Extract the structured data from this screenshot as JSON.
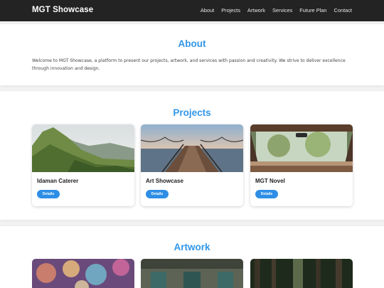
{
  "brand": "MGT Showcase",
  "nav": [
    "About",
    "Projects",
    "Artwork",
    "Services",
    "Future Plan",
    "Contact"
  ],
  "about": {
    "title": "About",
    "text": "Welcome to MGT Showcase, a platform to present our projects, artwork, and services with passion and creativity. We strive to deliver excellence through innovation and design."
  },
  "projects": {
    "title": "Projects",
    "items": [
      {
        "title": "Idaman Caterer",
        "button": "Details"
      },
      {
        "title": "Art Showcase",
        "button": "Details"
      },
      {
        "title": "MGT Novel",
        "button": "Details"
      }
    ]
  },
  "artwork": {
    "title": "Artwork"
  },
  "colors": {
    "accent": "#3296e8",
    "navbar": "#232323",
    "button": "#2e8ee6"
  }
}
